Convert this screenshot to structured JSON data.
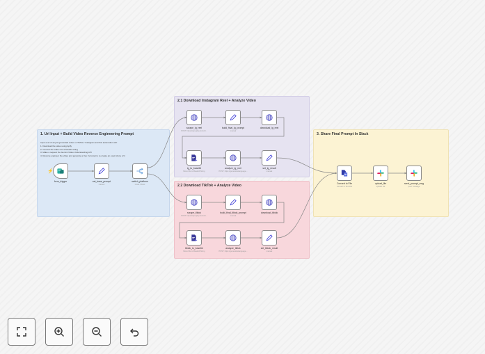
{
  "colors": {
    "blue_sticky": "#dce8f6",
    "purple_sticky": "#e6e3f1",
    "pink_sticky": "#f8d7dc",
    "yellow_sticky": "#fcf3d3",
    "edge": "#888888",
    "slack_purple": "#4a154b"
  },
  "stickies": {
    "s1": {
      "title": "1. Url Input + Build Video Reverse Engineering Prompt",
      "body": [
        "Input a url of any AI generated video on TikTok / Instagram and this automation will:",
        "1. Download the video using Apify",
        "2. Convert the video into a base64 string",
        "3. Make a request the Gemini Video Understanding API",
        "4. Reverse engineer the video and generate a Veo 3 prompt to re-create an exact clone of it"
      ]
    },
    "s2": {
      "title": "2.1 Download Instagram Reel + Analyze Video"
    },
    "s3": {
      "title": "2.2 Download TikTok + Analyze Video"
    },
    "s4": {
      "title": "3. Share Final Prompt In Slack"
    }
  },
  "nodes": {
    "form_trigger": {
      "label": "form_trigger",
      "sub": "",
      "icon": "form-icon"
    },
    "set_base_prompt": {
      "label": "set_base_prompt",
      "sub": "manual",
      "icon": "pencil-icon"
    },
    "switch_platform": {
      "label": "switch_platform",
      "sub": "mode: Rules",
      "icon": "switch-icon"
    },
    "scrape_ig_reel": {
      "label": "scrape_ig_reel",
      "sub": "POST: https://api.apify.com/v2/...",
      "icon": "globe-icon"
    },
    "build_final_ig_prompt": {
      "label": "build_final_ig_prompt",
      "sub": "manual",
      "icon": "pencil-icon"
    },
    "download_ig_reel": {
      "label": "download_ig_reel",
      "sub": "",
      "icon": "globe-icon"
    },
    "ig_to_base64": {
      "label": "ig_to_base64",
      "sub": "Move File to Base64 String",
      "icon": "file-convert-icon"
    },
    "analyze_ig_reel": {
      "label": "analyze_ig_reel",
      "sub": "POST: https://generativelanguage...",
      "icon": "globe-icon"
    },
    "set_ig_result": {
      "label": "set_ig_result",
      "sub": "manual",
      "icon": "pencil-icon"
    },
    "scrape_tiktok": {
      "label": "scrape_tiktok",
      "sub": "POST: https://api.apify.com/v2/...",
      "icon": "globe-icon"
    },
    "build_final_tiktok_prompt": {
      "label": "build_final_tiktok_prompt",
      "sub": "manual",
      "icon": "pencil-icon"
    },
    "download_tiktok": {
      "label": "download_tiktok",
      "sub": "",
      "icon": "globe-icon"
    },
    "tiktok_to_base64": {
      "label": "tiktok_to_base64",
      "sub": "Move File to Base64 String",
      "icon": "file-convert-icon"
    },
    "analyze_tiktok": {
      "label": "analyze_tiktok",
      "sub": "POST: https://generativelanguage...",
      "icon": "globe-icon"
    },
    "set_tiktok_result": {
      "label": "set_tiktok_result",
      "sub": "manual",
      "icon": "pencil-icon"
    },
    "convert_to_file": {
      "label": "Convert to File",
      "sub": "Convert to Text File",
      "icon": "convert-file-icon"
    },
    "upload_file": {
      "label": "upload_file",
      "sub": "upload: file",
      "icon": "slack-icon"
    },
    "send_prompt_msg": {
      "label": "send_prompt_msg",
      "sub": "post: message",
      "icon": "slack-icon"
    }
  },
  "controls": [
    {
      "name": "fit-view-button",
      "icon": "fit-view-icon"
    },
    {
      "name": "zoom-in-button",
      "icon": "zoom-in-icon"
    },
    {
      "name": "zoom-out-button",
      "icon": "zoom-out-icon"
    },
    {
      "name": "undo-button",
      "icon": "undo-icon"
    }
  ]
}
